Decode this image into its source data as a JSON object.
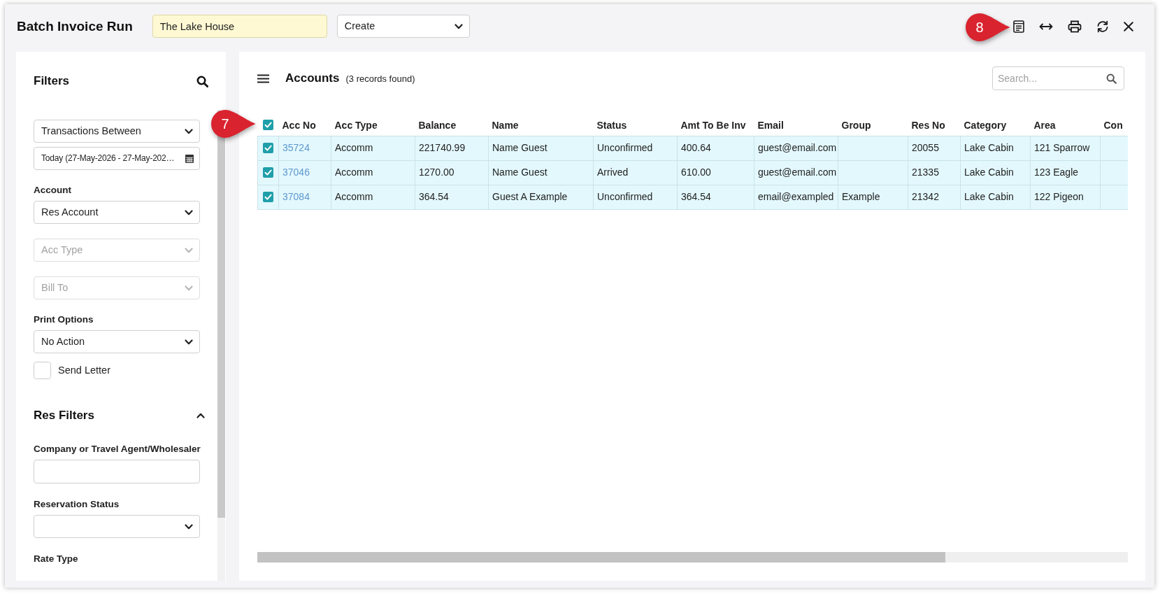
{
  "window": {
    "title": "Batch Invoice Run"
  },
  "header": {
    "property": {
      "value": "The Lake House"
    },
    "mode": {
      "value": "Create"
    },
    "toolbar": {
      "callout": "8"
    }
  },
  "filters": {
    "title": "Filters",
    "fields": [
      {
        "kind": "select",
        "value": "Transactions Between",
        "disabled": false
      },
      {
        "kind": "date",
        "value": "Today (27-May-2026 - 27-May-202…",
        "disabled": false
      },
      {
        "kind": "select",
        "label": "Account",
        "value": "Res Account",
        "disabled": false
      },
      {
        "kind": "select",
        "placeholder": "Acc Type",
        "disabled": true
      },
      {
        "kind": "select",
        "placeholder": "Bill To",
        "disabled": true
      },
      {
        "kind": "select",
        "label": "Print Options",
        "value": "No Action",
        "disabled": false
      },
      {
        "kind": "checkbox",
        "label": "Send Letter",
        "checked": false,
        "disabled": false
      }
    ]
  },
  "res_filters": {
    "title": "Res Filters",
    "expanded": true,
    "fields": [
      {
        "kind": "text",
        "label": "Company or Travel Agent/Wholesaler"
      },
      {
        "kind": "select",
        "label": "Reservation Status"
      },
      {
        "kind": "caption",
        "label": "Rate Type"
      }
    ]
  },
  "accounts": {
    "title": "Accounts",
    "count": "(3 records found)",
    "search": {
      "placeholder": "Search..."
    },
    "table": {
      "callout": "7",
      "select_all": {
        "checked": true
      },
      "columns": [
        "Acc No",
        "Acc Type",
        "Balance",
        "Name",
        "Status",
        "Amt To Be Inv",
        "Email",
        "Group",
        "Res No",
        "Category",
        "Area",
        "Con"
      ],
      "rows": [
        {
          "selected": true,
          "acc_no": "35724",
          "acc_type": "Accomm",
          "balance": "221740.99",
          "name": "Name Guest",
          "status": "Unconfirmed",
          "amt_to_be_inv": "400.64",
          "email": "guest@email.com",
          "res_no": "20055",
          "category": "Lake Cabin",
          "area": "121 Sparrow"
        },
        {
          "selected": true,
          "acc_no": "37046",
          "acc_type": "Accomm",
          "balance": "1270.00",
          "name": "Name Guest",
          "status": "Arrived",
          "amt_to_be_inv": "610.00",
          "email": "guest@email.com",
          "res_no": "21335",
          "category": "Lake Cabin",
          "area": "123 Eagle"
        },
        {
          "selected": true,
          "acc_no": "37084",
          "acc_type": "Accomm",
          "balance": "364.54",
          "name": "Guest A Example",
          "status": "Unconfirmed",
          "amt_to_be_inv": "364.54",
          "email": "email@exampled",
          "group": "Example",
          "res_no": "21342",
          "category": "Lake Cabin",
          "area": "122 Pigeon"
        }
      ]
    }
  }
}
